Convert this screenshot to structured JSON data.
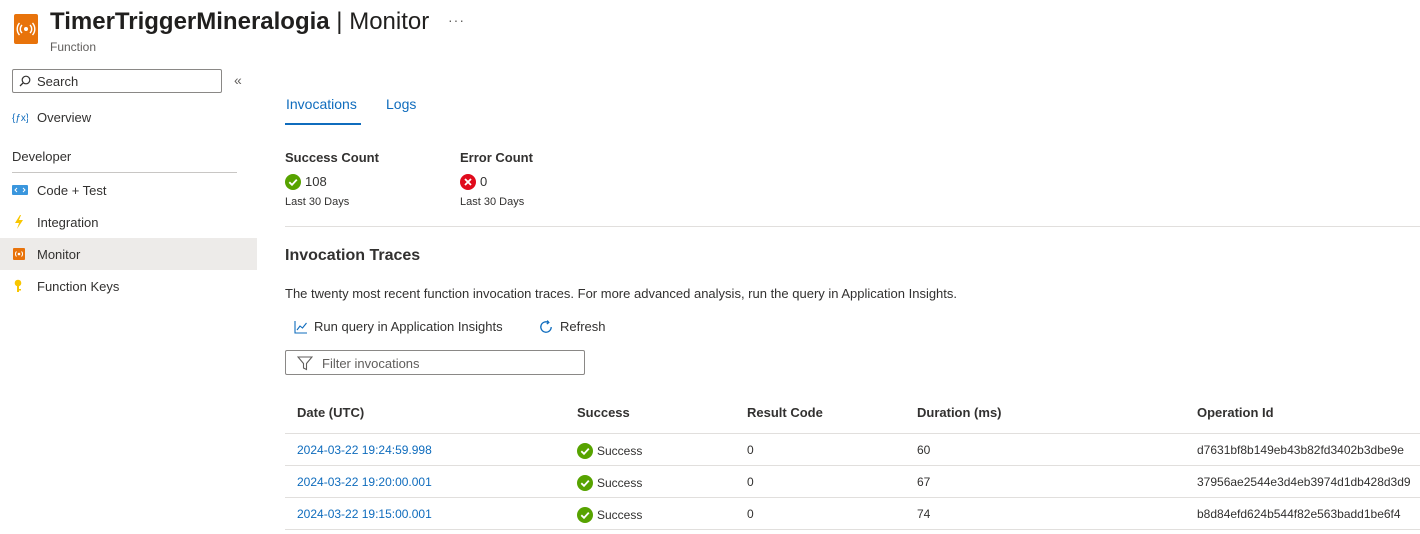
{
  "header": {
    "title": "TimerTriggerMineralogia",
    "separator": " | ",
    "section": "Monitor",
    "subtitle": "Function",
    "more": "···",
    "accent": "#e8730b"
  },
  "sidebar": {
    "search_placeholder": "Search",
    "collapse": "«",
    "overview": "Overview",
    "section_label": "Developer",
    "items": [
      {
        "label": "Code + Test",
        "icon": "code-icon"
      },
      {
        "label": "Integration",
        "icon": "lightning-icon"
      },
      {
        "label": "Monitor",
        "icon": "monitor-icon",
        "active": true
      },
      {
        "label": "Function Keys",
        "icon": "key-icon"
      }
    ]
  },
  "tabs": [
    {
      "label": "Invocations",
      "active": true
    },
    {
      "label": "Logs"
    }
  ],
  "stats": {
    "success": {
      "title": "Success Count",
      "value": "108",
      "sub": "Last 30 Days",
      "color": "#57a300"
    },
    "error": {
      "title": "Error Count",
      "value": "0",
      "sub": "Last 30 Days",
      "color": "#e00b1c"
    }
  },
  "traces": {
    "title": "Invocation Traces",
    "description": "The twenty most recent function invocation traces. For more advanced analysis, run the query in Application Insights.",
    "run_query": "Run query in Application Insights",
    "refresh": "Refresh",
    "filter_placeholder": "Filter invocations"
  },
  "table": {
    "columns": [
      "Date (UTC)",
      "Success",
      "Result Code",
      "Duration (ms)",
      "Operation Id"
    ],
    "rows": [
      {
        "date": "2024-03-22 19:24:59.998",
        "success": "Success",
        "code": "0",
        "duration": "60",
        "op": "d7631bf8b149eb43b82fd3402b3dbe9e"
      },
      {
        "date": "2024-03-22 19:20:00.001",
        "success": "Success",
        "code": "0",
        "duration": "67",
        "op": "37956ae2544e3d4eb3974d1db428d3d9"
      },
      {
        "date": "2024-03-22 19:15:00.001",
        "success": "Success",
        "code": "0",
        "duration": "74",
        "op": "b8d84efd624b544f82e563badd1be6f4"
      }
    ]
  }
}
